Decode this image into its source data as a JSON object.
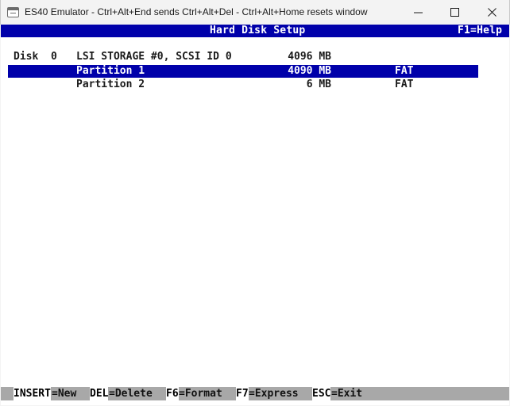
{
  "window": {
    "title": "ES40 Emulator - Ctrl+Alt+End sends Ctrl+Alt+Del - Ctrl+Alt+Home resets window",
    "minimize_glyph": "—",
    "maximize_glyph": "☐",
    "close_glyph": "✕"
  },
  "header": {
    "title": "Hard Disk Setup",
    "help": "F1=Help"
  },
  "disk": {
    "label": "Disk",
    "number": "0",
    "name": "LSI STORAGE #0, SCSI ID 0",
    "size": "4096 MB"
  },
  "partitions": [
    {
      "name": "Partition 1",
      "size": "4090 MB",
      "fs": "FAT",
      "selected": true
    },
    {
      "name": "Partition 2",
      "size": "6 MB",
      "fs": "FAT",
      "selected": false
    }
  ],
  "footer": [
    {
      "key": "INSERT",
      "action": "=New"
    },
    {
      "key": "DEL",
      "action": "=Delete"
    },
    {
      "key": "F6",
      "action": "=Format"
    },
    {
      "key": "F7",
      "action": "=Express"
    },
    {
      "key": "ESC",
      "action": "=Exit"
    }
  ],
  "colors": {
    "accent_blue": "#0000aa",
    "footer_gray": "#a8a8a8"
  }
}
